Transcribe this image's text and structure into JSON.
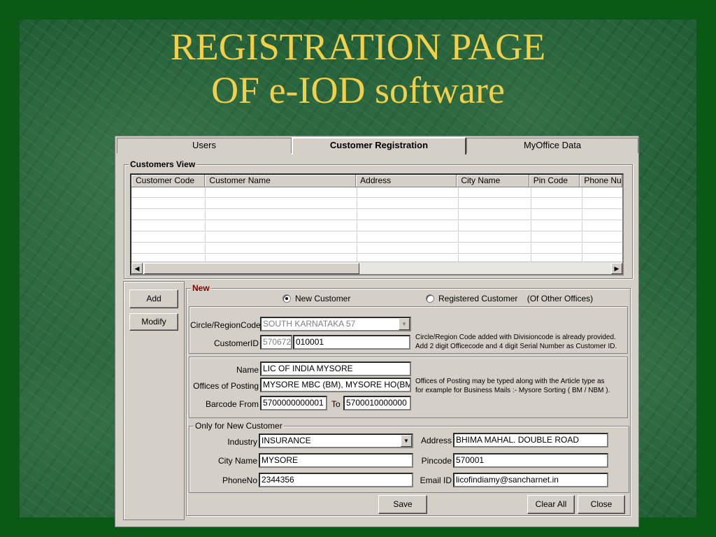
{
  "slide": {
    "title_line1": "REGISTRATION PAGE",
    "title_line2": "OF e-IOD software",
    "background_color": "#1c5a33",
    "title_color": "#f2d04a"
  },
  "tabs": [
    {
      "label": "Users",
      "active": false
    },
    {
      "label": "Customer Registration",
      "active": true
    },
    {
      "label": "MyOffice Data",
      "active": false
    }
  ],
  "customers_view": {
    "title": "Customers View",
    "columns": [
      "Customer Code",
      "Customer Name",
      "Address",
      "City Name",
      "Pin Code",
      "Phone Nu"
    ],
    "rows": []
  },
  "actions": {
    "add_label": "Add",
    "modify_label": "Modify"
  },
  "new_section": {
    "title": "New",
    "radio_new": "New Customer",
    "radio_registered": "Registered Customer    (Of Other Offices)",
    "selected": "new"
  },
  "circle": {
    "circle_label": "Circle/RegionCode",
    "circle_value": "SOUTH KARNATAKA  57",
    "customer_id_label": "CustomerID",
    "customer_id_prefix": "570672",
    "customer_id_value": "010001",
    "note_line1": "Circle/Region Code added with Divisioncode is already provided.",
    "note_line2": "Add 2 digit Officecode and 4 digit Serial Number as Customer ID."
  },
  "details": {
    "name_label": "Name",
    "name_value": "LIC OF INDIA MYSORE",
    "offices_label": "Offices of Posting",
    "offices_value": "MYSORE MBC (BM), MYSORE HO(BM)",
    "barcode_label": "Barcode  From",
    "barcode_from": "5700000000001",
    "barcode_to_label": "To",
    "barcode_to": "5700010000000",
    "note_line1": "Offices of Posting may be typed along with the Article type as",
    "note_line2": "for example for Business Mails :- Mysore Sorting ( BM / NBM )."
  },
  "only_new": {
    "title": "Only for New Customer",
    "industry_label": "Industry",
    "industry_value": "INSURANCE",
    "city_label": "City Name",
    "city_value": "MYSORE",
    "phone_label": "PhoneNo",
    "phone_value": "2344356",
    "address_label": "Address",
    "address_value": "BHIMA MAHAL. DOUBLE ROAD",
    "pincode_label": "Pincode",
    "pincode_value": "570001",
    "email_label": "Email ID",
    "email_value": "licofindiamy@sancharnet.in"
  },
  "footer": {
    "save_label": "Save",
    "clear_all_label": "Clear All",
    "close_label": "Close"
  }
}
